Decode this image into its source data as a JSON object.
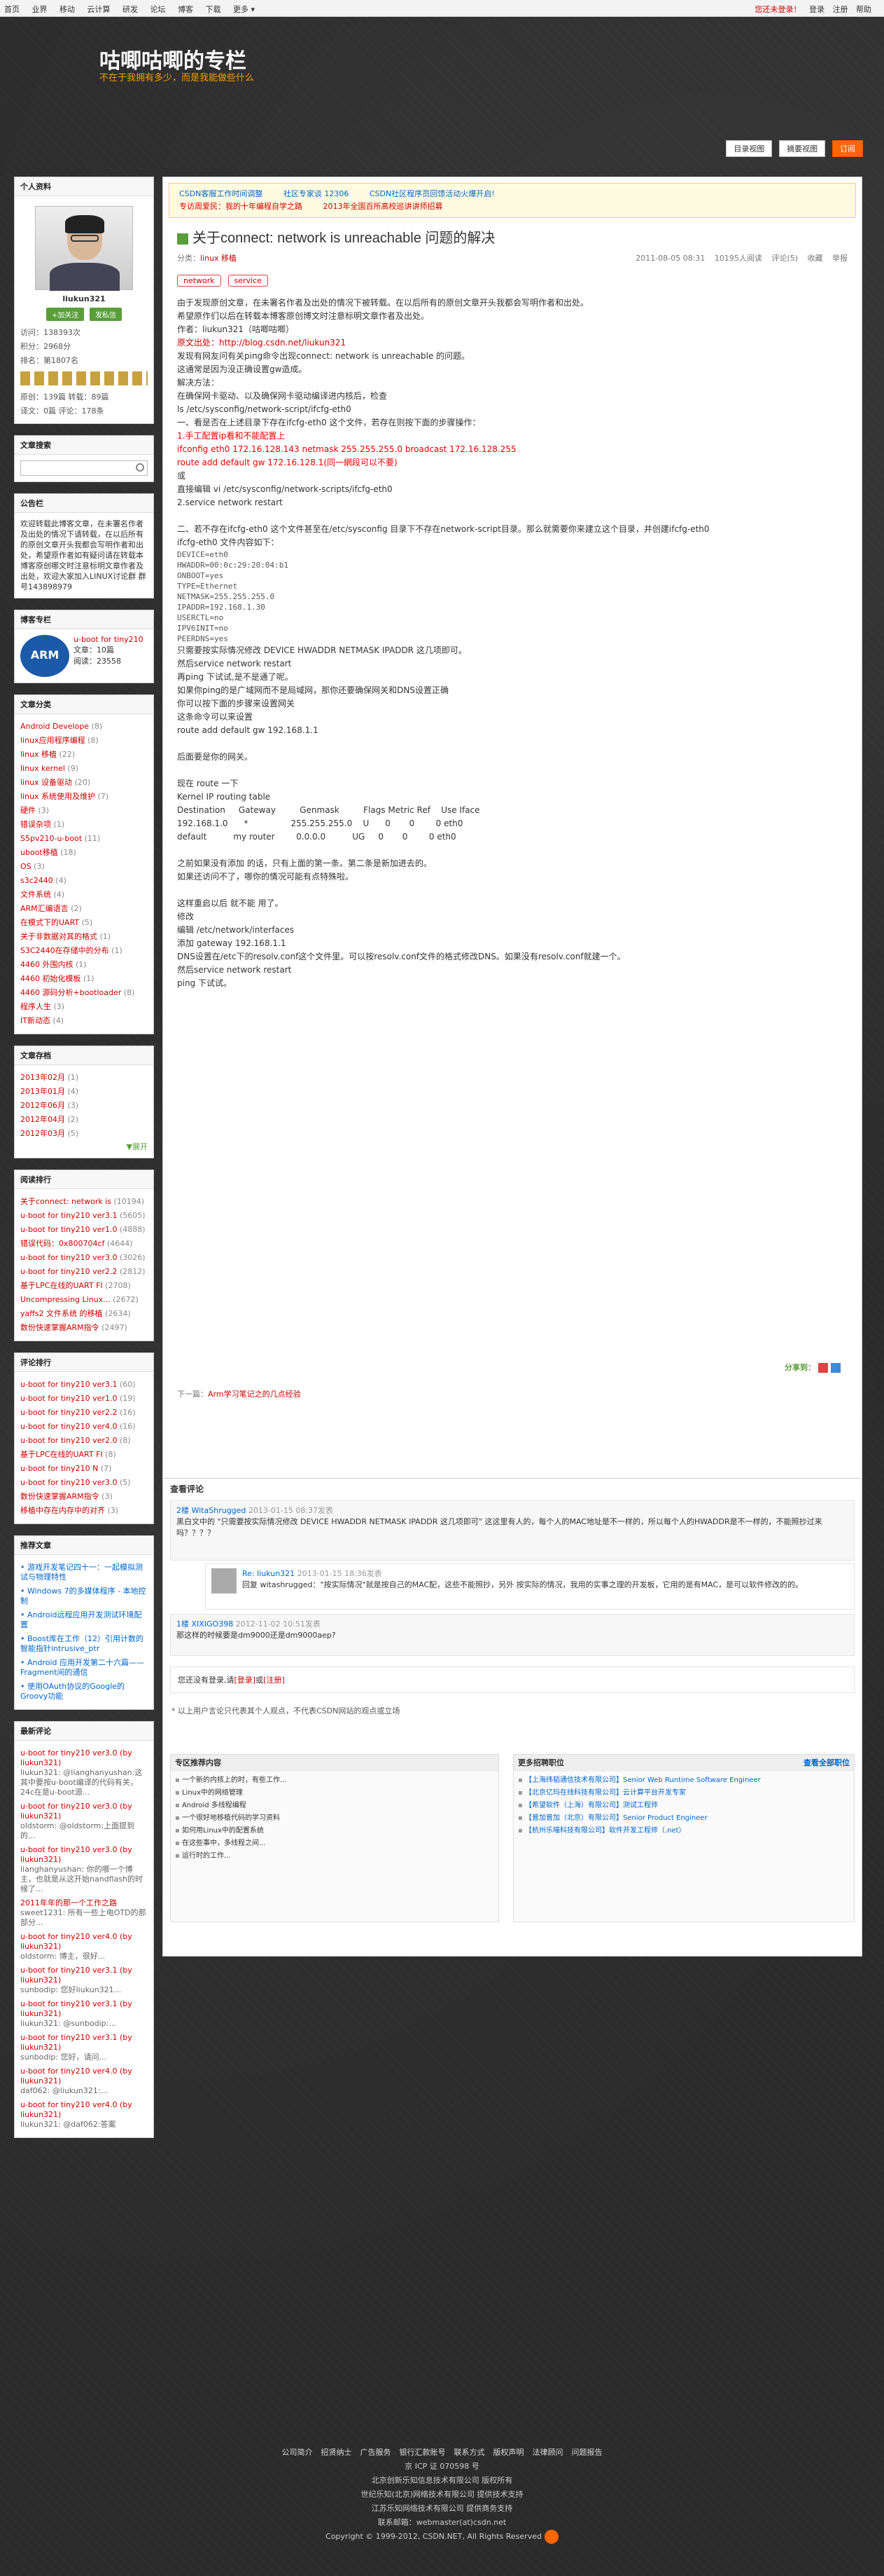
{
  "topbar": {
    "left": [
      "首页",
      "业界",
      "移动",
      "云计算",
      "研发",
      "论坛",
      "博客",
      "下载",
      "更多 ▾"
    ],
    "right": [
      "您还未登录！",
      "登录",
      "注册",
      "帮助"
    ]
  },
  "header": {
    "title": "咕唧咕唧的专栏",
    "subtitle": "不在于我拥有多少，而是我能做些什么"
  },
  "view_tabs": [
    "目录视图",
    "摘要视图",
    "订阅"
  ],
  "profile": {
    "heading": "个人资料",
    "name": "liukun321",
    "follow": "+加关注",
    "message": "发私信",
    "stats": [
      "访问：138393次",
      "积分：2968分",
      "排名：第1807名"
    ],
    "stats2": [
      "原创：139篇  转载：89篇",
      "译文：0篇  评论：178条"
    ]
  },
  "search": {
    "heading": "文章搜索"
  },
  "announce": {
    "heading": "公告栏",
    "text": "欢迎转载此博客文章，在未署名作者及出处的情况下请转载，在以后所有的原创文章开头我都会写明作者和出处，希望原作者如有疑问请在转载本博客原创哪文时注意标明文章作者及出处，欢迎大家加入LINUX讨论群 群号143898979"
  },
  "expert": {
    "heading": "博客专栏",
    "name": "u-boot for tiny210",
    "count": "文章：10篇",
    "reads": "阅读：23558"
  },
  "categories": {
    "heading": "文章分类",
    "items": [
      {
        "name": "Android Develope",
        "count": "(8)"
      },
      {
        "name": "linux应用程序编程",
        "count": "(8)"
      },
      {
        "name": "linux 移植",
        "count": "(22)"
      },
      {
        "name": "linux kernel",
        "count": "(9)"
      },
      {
        "name": "linux 设备驱动",
        "count": "(20)"
      },
      {
        "name": "linux 系统使用及维护",
        "count": "(7)"
      },
      {
        "name": "硬件",
        "count": "(3)"
      },
      {
        "name": "错误杂项",
        "count": "(1)"
      },
      {
        "name": "S5pv210-u-boot",
        "count": "(11)"
      },
      {
        "name": "uboot移植",
        "count": "(18)"
      },
      {
        "name": "OS",
        "count": "(3)"
      },
      {
        "name": "s3c2440",
        "count": "(4)"
      },
      {
        "name": "文件系统",
        "count": "(4)"
      },
      {
        "name": "ARM汇编语言",
        "count": "(2)"
      },
      {
        "name": "在模式下的UART",
        "count": "(5)"
      },
      {
        "name": "关于非数据对其的格式",
        "count": "(1)"
      },
      {
        "name": "S3C2440在存储中的分布",
        "count": "(1)"
      },
      {
        "name": "4460 外围内核",
        "count": "(1)"
      },
      {
        "name": "4460 初始化模板",
        "count": "(1)"
      },
      {
        "name": "4460 源码分析+bootloader",
        "count": "(8)"
      },
      {
        "name": "程序人生",
        "count": "(3)"
      },
      {
        "name": "IT新动态",
        "count": "(4)"
      }
    ]
  },
  "archive": {
    "heading": "文章存档",
    "items": [
      {
        "name": "2013年02月",
        "count": "(1)"
      },
      {
        "name": "2013年01月",
        "count": "(4)"
      },
      {
        "name": "2012年06月",
        "count": "(3)"
      },
      {
        "name": "2012年04月",
        "count": "(2)"
      },
      {
        "name": "2012年03月",
        "count": "(5)"
      }
    ],
    "more": "▼展开"
  },
  "ranking": {
    "heading": "阅读排行",
    "items": [
      {
        "name": "关于connect: network is",
        "count": "(10194)"
      },
      {
        "name": "u-boot for tiny210 ver3.1",
        "count": "(5605)"
      },
      {
        "name": "u-boot for tiny210 ver1.0",
        "count": "(4888)"
      },
      {
        "name": "错误代码：0x800704cf",
        "count": "(4644)"
      },
      {
        "name": "u-boot for tiny210 ver3.0",
        "count": "(3026)"
      },
      {
        "name": "u-boot for tiny210 ver2.2",
        "count": "(2812)"
      },
      {
        "name": "基于LPC在线的UART FI",
        "count": "(2708)"
      },
      {
        "name": "Uncompressing Linux...",
        "count": "(2672)"
      },
      {
        "name": "yaffs2 文件系统 的移植",
        "count": "(2634)"
      },
      {
        "name": "数份快速掌握ARM指令",
        "count": "(2497)"
      }
    ]
  },
  "comment_rank": {
    "heading": "评论排行",
    "items": [
      {
        "name": "u-boot for tiny210 ver3.1",
        "count": "(60)"
      },
      {
        "name": "u-boot for tiny210 ver1.0",
        "count": "(19)"
      },
      {
        "name": "u-boot for tiny210 ver2.2",
        "count": "(16)"
      },
      {
        "name": "u-boot for tiny210 ver4.0",
        "count": "(16)"
      },
      {
        "name": "u-boot for tiny210 ver2.0",
        "count": "(8)"
      },
      {
        "name": "基于LPC在线的UART FI",
        "count": "(8)"
      },
      {
        "name": "u-boot for tiny210 N",
        "count": "(7)"
      },
      {
        "name": "u-boot for tiny210 ver3.0",
        "count": "(5)"
      },
      {
        "name": "数份快速掌握ARM指令",
        "count": "(3)"
      },
      {
        "name": "移植中存在内存中的对齐",
        "count": "(3)"
      }
    ]
  },
  "recommended": {
    "heading": "推荐文章",
    "items": [
      "游戏开发笔记四十一：一起模拟测试与物理特性",
      "Windows 7的多媒体程序 - 本地控制",
      "Android远程应用开发测试环境配置",
      "Boost库在工作（12）引用计数的智能指针intrusive_ptr",
      "Android 应用开发第二十六篇——Fragment间的通信",
      "使用OAuth协议的Google的Groovy功能"
    ]
  },
  "latest_comments": {
    "heading": "最新评论",
    "items": [
      {
        "title": "u-boot for tiny210 ver3.0 (by liukun321)",
        "text": "liukun321: @lianghanyushan:这其中要按u-boot编译的代码有关，24c在是u-boot源..."
      },
      {
        "title": "u-boot for tiny210 ver3.0 (by liukun321)",
        "text": "oldstorm: @oldstorm:上面提到的..."
      },
      {
        "title": "u-boot for tiny210 ver3.0 (by liukun321)",
        "text": "lianghanyushan: 你的哪一个博主，也就是从这开始nandflash的时候了..."
      },
      {
        "title": "2011年年的那一个工作之路",
        "text": "sweet1231: 所有一些上电OTD的那部分..."
      },
      {
        "title": "u-boot for tiny210 ver4.0 (by liukun321)",
        "text": "oldstorm: 博主，很好..."
      },
      {
        "title": "u-boot for tiny210 ver3.1 (by liukun321)",
        "text": "sunbodip: 您好liukun321..."
      },
      {
        "title": "u-boot for tiny210 ver3.1 (by liukun321)",
        "text": "liukun321: @sunbodip:..."
      },
      {
        "title": "u-boot for tiny210 ver3.1 (by liukun321)",
        "text": "sunbodip: 您好，请问..."
      },
      {
        "title": "u-boot for tiny210 ver4.0 (by liukun321)",
        "text": "daf062: @liukun321:..."
      },
      {
        "title": "u-boot for tiny210 ver4.0 (by liukun321)",
        "text": "liukun321: @daf062:答案"
      }
    ]
  },
  "notice": {
    "row1": [
      "CSDN客服工作时间调整",
      "社区专家谈 12306",
      "CSDN社区程序员回馈活动火爆开启!"
    ],
    "row2": [
      "专访周爱民：我的十年编程自学之路",
      "2013年全国百所高校巡讲讲师招募"
    ]
  },
  "article": {
    "title": "关于connect: network is unreachable 问题的解决",
    "category_label": "分类：",
    "category": "linux 移植",
    "meta": [
      "2011-08-05 08:31",
      "10195人阅读",
      "评论(5)",
      "收藏",
      "举报"
    ],
    "tags": [
      "network",
      "service"
    ],
    "para1": [
      "由于发现原创文章，在未署名作者及出处的情况下被转载。在以后所有的原创文章开头我都会写明作者和出处。",
      "希望原作们以后在转载本博客原创博文时注意标明文章作者及出处。",
      "作者：liukun321（咕唧咕唧）",
      "原文出处：http://blog.csdn.net/liukun321",
      "发现有网友问有关ping命令出现connect: network is unreachable 的问题。",
      "这通常是因为没正确设置gw造成。",
      "解决方法：",
      "在确保网卡驱动、以及确保网卡驱动编译进内核后，检查",
      "ls /etc/sysconfig/network-script/ifcfg-eth0",
      "一、看是否在上述目录下存在ifcfg-eth0 这个文件，若存在则按下面的步骤操作："
    ],
    "red": [
      "1.手工配置ip看和不能配置上",
      "ifconfig eth0 172.16.128.143 netmask 255.255.255.0 broadcast 172.16.128.255",
      "route add default gw 172.16.128.1(同一網段可以不要)"
    ],
    "para2": [
      "或",
      "直接编辑 vi /etc/sysconfig/network-scripts/ifcfg-eth0",
      "2.service network restart"
    ],
    "para3": [
      "二、若不存在ifcfg-eth0 这个文件甚至在/etc/sysconfig 目录下不存在network-script目录。那么就需要你来建立这个目录，并创建ifcfg-eth0",
      "ifcfg-eth0 文件内容如下："
    ],
    "code": "DEVICE=eth0\nHWADDR=00:0c:29:20:04:b1\nONBOOT=yes\nTYPE=Ethernet\nNETMASK=255.255.255.0\nIPADDR=192.168.1.30\nUSERCTL=no\nIPV6INIT=no\nPEERDNS=yes",
    "para4": [
      "只需要按实际情况修改 DEVICE HWADDR NETMASK IPADDR 这几项即可。",
      "然后service network restart",
      "再ping 下试试,是不是通了呢。",
      "如果你ping的是广域网而不是局域网，那你还要确保网关和DNS设置正确",
      "你可以按下面的步骤来设置网关",
      "这条命令可以来设置",
      "route add default  gw 192.168.1.1"
    ],
    "para5": [
      "后面要是你的网关。"
    ],
    "para6": [
      "现在 route 一下",
      "Kernel IP routing table",
      "Destination     Gateway         Genmask         Flags Metric Ref    Use Iface",
      "192.168.1.0      *                255.255.255.0    U      0       0        0 eth0",
      "default          my router        0.0.0.0          UG     0       0        0 eth0"
    ],
    "para7": [
      "之前如果没有添加 的话，只有上面的第一条。第二条是新加进去的。",
      "如果还访问不了，哪你的情况可能有点特殊啦。"
    ],
    "para8": [
      "这样重启以后 就不能 用了。",
      "修改",
      "编辑  /etc/network/interfaces",
      "添加 gateway 192.168.1.1",
      "DNS设置在/etc下的resolv.conf这个文件里。可以按resolv.conf文件的格式修改DNS。如果没有resolv.conf就建一个。",
      "然后service network restart",
      "ping 下试试。"
    ],
    "share_label": "分享到：",
    "prev_label": "下一篇：",
    "prev_title": "Arm学习笔记之的几点经验"
  },
  "comments": {
    "heading": "查看评论",
    "c1_who": "2楼 WitaShrugged",
    "c1_when": "2013-01-15 08:37发表",
    "c1_text": "黑白文中的 \"只需要按实际情况修改 DEVICE HWADDR NETMASK IPADDR 这几项即可\"  这这里有人的，每个人的MAC地址是不一样的，所以每个人的HWADDR是不一样的，不能照抄过来吗？？？？",
    "c1r_who": "Re: liukun321",
    "c1r_when": "2013-01-15 18:36发表",
    "c1r_text": "回复 witashrugged：\"按实际情况\"就是按自己的MAC配，这些不能照抄，另外 按实际的情况，我用的实事之理的开发板，它用的是有MAC，是可以软件修改的的。",
    "c2_who": "1楼 XIXIGO398",
    "c2_when": "2012-11-02 10:51发表",
    "c2_text": "那这样的时候要是dm9000还是dm9000aep?",
    "login_prefix": "您还没有登录,请",
    "login_link": "[登录]",
    "login_or": "或",
    "login_reg": "[注册]",
    "footnote": "* 以上用户言论只代表其个人观点，不代表CSDN网站的观点或立场"
  },
  "related": {
    "heading": "专区推荐内容",
    "items": [
      "一个新的内核上的时，有些工作...",
      "Linux中的网络管理",
      "Android 多线程编程",
      "一个很好地移植代码的学习资料",
      "如何用Linux中的配置系统",
      "在这些事中，多线程之间...",
      "运行时的工作..."
    ],
    "jobs_heading": "更多招聘职位",
    "jobs_note": "查看全部职位",
    "jobs": [
      "【上海纬韬通信技术有限公司】Senior Web Runtime Software Engineer",
      "【北京亿玛在线科技有限公司】云计算平台开发专家",
      "【希望软件（上海）有限公司】测试工程师",
      "【普加普加（北京）有限公司】Senior Product Engineer",
      "【杭州乐喵科技有限公司】软件开发工程师（.net）"
    ]
  },
  "footer": {
    "links": [
      "公司简介",
      "招贤纳士",
      "广告服务",
      "银行汇款账号",
      "联系方式",
      "版权声明",
      "法律顾问",
      "问题报告"
    ],
    "lines": [
      "京 ICP 证 070598 号",
      "北京创新乐知信息技术有限公司 版权所有",
      "世纪乐知(北京)网络技术有限公司 提供技术支持",
      "江苏乐知网络技术有限公司 提供商务支持",
      "联系邮箱：webmaster(at)csdn.net",
      "Copyright © 1999-2012, CSDN.NET, All Rights Reserved"
    ]
  }
}
